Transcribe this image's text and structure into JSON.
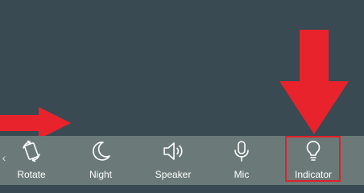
{
  "quick_settings": {
    "items": [
      {
        "id": "rotate",
        "label": "Rotate",
        "icon": "rotate-icon"
      },
      {
        "id": "night",
        "label": "Night",
        "icon": "moon-icon"
      },
      {
        "id": "speaker",
        "label": "Speaker",
        "icon": "speaker-icon"
      },
      {
        "id": "mic",
        "label": "Mic",
        "icon": "mic-icon"
      },
      {
        "id": "indicator",
        "label": "Indicator",
        "icon": "lightbulb-icon"
      }
    ],
    "highlighted": "indicator",
    "scroll_left_icon": "chevron-left-icon"
  },
  "colors": {
    "background": "#394a53",
    "bar": "#6b7a78",
    "annotation": "#e0202a",
    "label": "#ffffff"
  }
}
